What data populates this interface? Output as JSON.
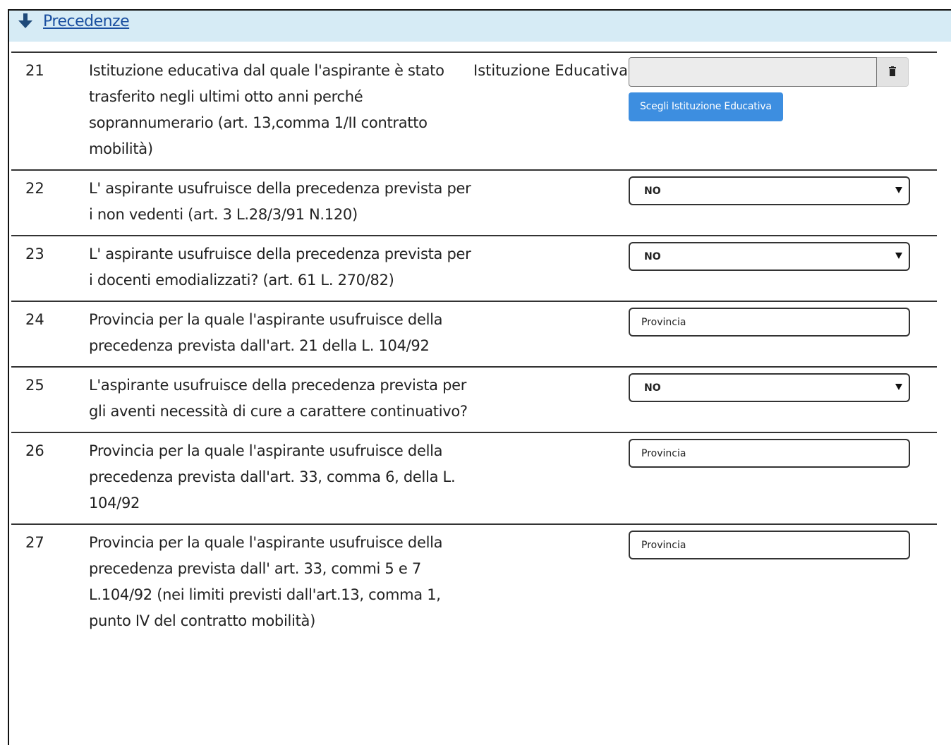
{
  "section": {
    "title": "Precedenze",
    "icon": "arrow-down-icon"
  },
  "rows": [
    {
      "num": "21",
      "desc": "Istituzione educativa dal quale l'aspirante è stato trasferito negli ultimi otto anni perché soprannumerario (art. 13,comma 1/II contratto mobilità)",
      "label": "Istituzione Educativa",
      "control": "istituzione",
      "field_value": "",
      "button_label": "Scegli Istituzione Educativa"
    },
    {
      "num": "22",
      "desc": "L' aspirante usufruisce della precedenza prevista per i non vedenti (art. 3 L.28/3/91 N.120)",
      "label": "",
      "control": "select",
      "value": "NO"
    },
    {
      "num": "23",
      "desc": "L' aspirante usufruisce della precedenza prevista per i docenti emodializzati? (art. 61 L. 270/82)",
      "label": "",
      "control": "select",
      "value": "NO"
    },
    {
      "num": "24",
      "desc": "Provincia per la quale l'aspirante usufruisce della precedenza prevista dall'art. 21 della L. 104/92",
      "label": "",
      "control": "text",
      "placeholder": "Provincia"
    },
    {
      "num": "25",
      "desc": "L'aspirante usufruisce della precedenza prevista per gli aventi necessità di cure a carattere continuativo?",
      "label": "",
      "control": "select",
      "value": "NO"
    },
    {
      "num": "26",
      "desc": "Provincia per la quale l'aspirante usufruisce della precedenza prevista dall'art. 33, comma 6, della L. 104/92",
      "label": "",
      "control": "text",
      "placeholder": "Provincia"
    },
    {
      "num": "27",
      "desc": "Provincia per la quale l'aspirante usufruisce della precedenza prevista dall' art. 33, commi 5 e 7 L.104/92 (nei limiti previsti dall'art.13, comma 1, punto IV del contratto mobilità)",
      "label": "",
      "control": "text",
      "placeholder": "Provincia"
    }
  ],
  "icons": {
    "trash": "trash-icon",
    "caret": "caret-down-icon"
  },
  "colors": {
    "header_bg": "#d6ebf5",
    "link": "#1a4fa0",
    "button_bg": "#3d8ee0"
  }
}
